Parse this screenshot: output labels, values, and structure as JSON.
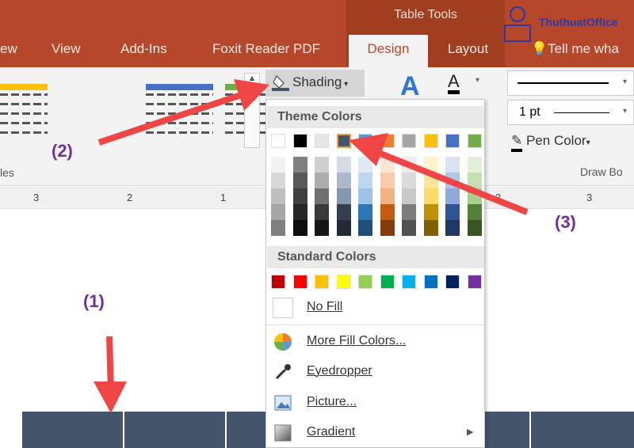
{
  "ribbon": {
    "tabs": [
      "ew",
      "View",
      "Add-Ins",
      "Foxit Reader PDF",
      "Design",
      "Layout",
      "Tell me wha"
    ],
    "context_tab": "Table Tools",
    "logo": "ThuthuatOffice",
    "group_styles": "les",
    "group_draw": "Draw Bo",
    "shading_label": "Shading",
    "line_weight": "1 pt",
    "pen_color": "Pen Color"
  },
  "ruler": {
    "ticks": [
      "3",
      "2",
      "1",
      "3",
      "3"
    ]
  },
  "menu": {
    "theme_header": "Theme Colors",
    "standard_header": "Standard Colors",
    "theme_colors": [
      "#ffffff",
      "#000000",
      "#e7e6e6",
      "#44546a",
      "#5b9bd5",
      "#ed7d31",
      "#a5a5a5",
      "#ffc000",
      "#4472c4",
      "#70ad47"
    ],
    "theme_shades": [
      [
        "#f2f2f2",
        "#d9d9d9",
        "#bfbfbf",
        "#a6a6a6",
        "#808080"
      ],
      [
        "#808080",
        "#595959",
        "#404040",
        "#262626",
        "#0d0d0d"
      ],
      [
        "#d0cece",
        "#aeabab",
        "#757070",
        "#3a3838",
        "#171616"
      ],
      [
        "#d6dce4",
        "#adb9ca",
        "#8497b0",
        "#333f4f",
        "#222a35"
      ],
      [
        "#deebf6",
        "#bdd7ee",
        "#9dc3e6",
        "#2e75b5",
        "#1f4e79"
      ],
      [
        "#fbe5d5",
        "#f7cbac",
        "#f4b183",
        "#c55a11",
        "#843c0b"
      ],
      [
        "#ededed",
        "#dbdbdb",
        "#c9c9c9",
        "#7b7b7b",
        "#525252"
      ],
      [
        "#fff2cc",
        "#fee599",
        "#ffd965",
        "#bf9000",
        "#7f6000"
      ],
      [
        "#d9e2f3",
        "#b4c6e7",
        "#8eaadb",
        "#2f5496",
        "#1f3864"
      ],
      [
        "#e2efd9",
        "#c5e0b3",
        "#a8d08d",
        "#538135",
        "#375623"
      ]
    ],
    "selected_index": 3,
    "standard_colors": [
      "#c00000",
      "#ff0000",
      "#ffc000",
      "#ffff00",
      "#92d050",
      "#00b050",
      "#00b0f0",
      "#0070c0",
      "#002060",
      "#7030a0"
    ],
    "items": [
      "No Fill",
      "More Fill Colors...",
      "Eyedropper",
      "Picture...",
      "Gradient"
    ]
  },
  "annotations": [
    "(1)",
    "(2)",
    "(3)"
  ],
  "colors": {
    "accent": "#b7472a",
    "table": "#44546a",
    "arrow": "#f04040"
  }
}
